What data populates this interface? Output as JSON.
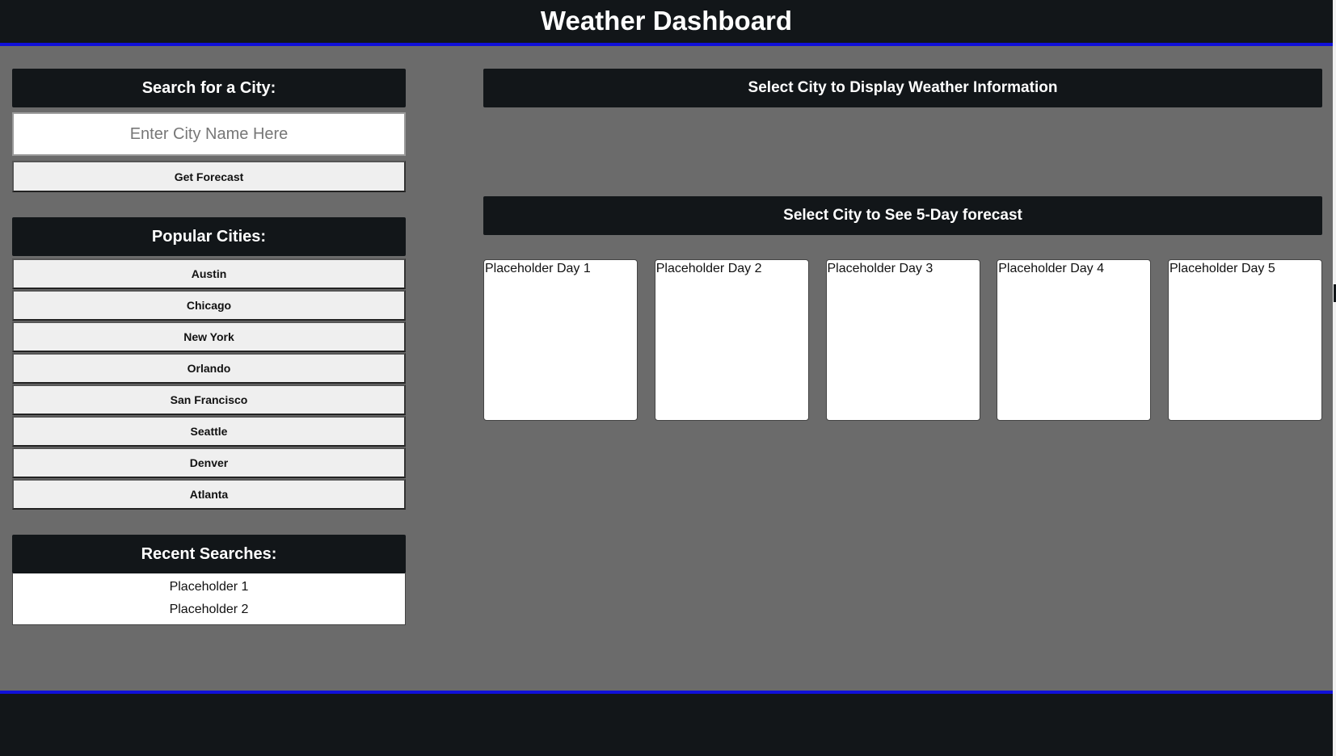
{
  "header": {
    "title": "Weather Dashboard"
  },
  "search": {
    "heading": "Search for a City:",
    "placeholder": "Enter City Name Here",
    "value": "",
    "button_label": "Get Forecast"
  },
  "popular": {
    "heading": "Popular Cities:",
    "cities": [
      "Austin",
      "Chicago",
      "New York",
      "Orlando",
      "San Francisco",
      "Seattle",
      "Denver",
      "Atlanta"
    ]
  },
  "recent": {
    "heading": "Recent Searches:",
    "items": [
      "Placeholder 1",
      "Placeholder 2"
    ]
  },
  "current": {
    "heading": "Select City to Display Weather Information"
  },
  "forecast": {
    "heading": "Select City to See 5-Day forecast",
    "days": [
      "Placeholder Day 1",
      "Placeholder Day 2",
      "Placeholder Day 3",
      "Placeholder Day 4",
      "Placeholder Day 5"
    ]
  },
  "colors": {
    "background": "#6b6b6b",
    "header_bg": "#121619",
    "accent_border": "#1010d8",
    "button_bg": "#efefef",
    "card_bg": "#ffffff"
  }
}
